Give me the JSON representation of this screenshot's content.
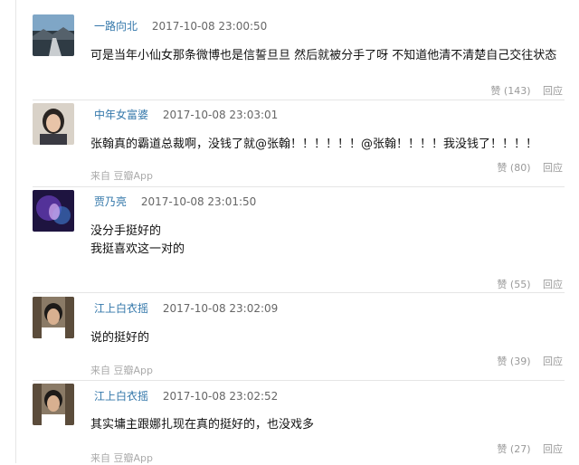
{
  "comments": [
    {
      "user": "一路向北",
      "time": "2017-10-08 23:00:50",
      "lines": [
        "可是当年小仙女那条微博也是信誓旦旦 然后就被分手了呀 不知道他清不清楚自己交往状态"
      ],
      "source": "",
      "like": "赞 (143)",
      "reply": "回应",
      "avatar_icon": "landscape-avatar"
    },
    {
      "user": "中年女富婆",
      "time": "2017-10-08 23:03:01",
      "lines": [
        "张翰真的霸道总裁啊，没钱了就@张翰！！！！！！@张翰！！！！我没钱了！！！！"
      ],
      "source": "来自 豆瓣App",
      "like": "赞 (80)",
      "reply": "回应",
      "avatar_icon": "person-avatar"
    },
    {
      "user": "贾乃亮",
      "time": "2017-10-08 23:01:50",
      "lines": [
        "没分手挺好的",
        "我挺喜欢这一对的"
      ],
      "source": "",
      "like": "赞 (55)",
      "reply": "回应",
      "avatar_icon": "concert-avatar"
    },
    {
      "user": "江上白衣摇",
      "time": "2017-10-08 23:02:09",
      "lines": [
        "说的挺好的"
      ],
      "source": "来自 豆瓣App",
      "like": "赞 (39)",
      "reply": "回应",
      "avatar_icon": "man-avatar"
    },
    {
      "user": "江上白衣摇",
      "time": "2017-10-08 23:02:52",
      "lines": [
        "其实墉主跟娜扎现在真的挺好的，也没戏多"
      ],
      "source": "来自 豆瓣App",
      "like": "赞 (27)",
      "reply": "回应",
      "avatar_icon": "man-avatar"
    }
  ]
}
